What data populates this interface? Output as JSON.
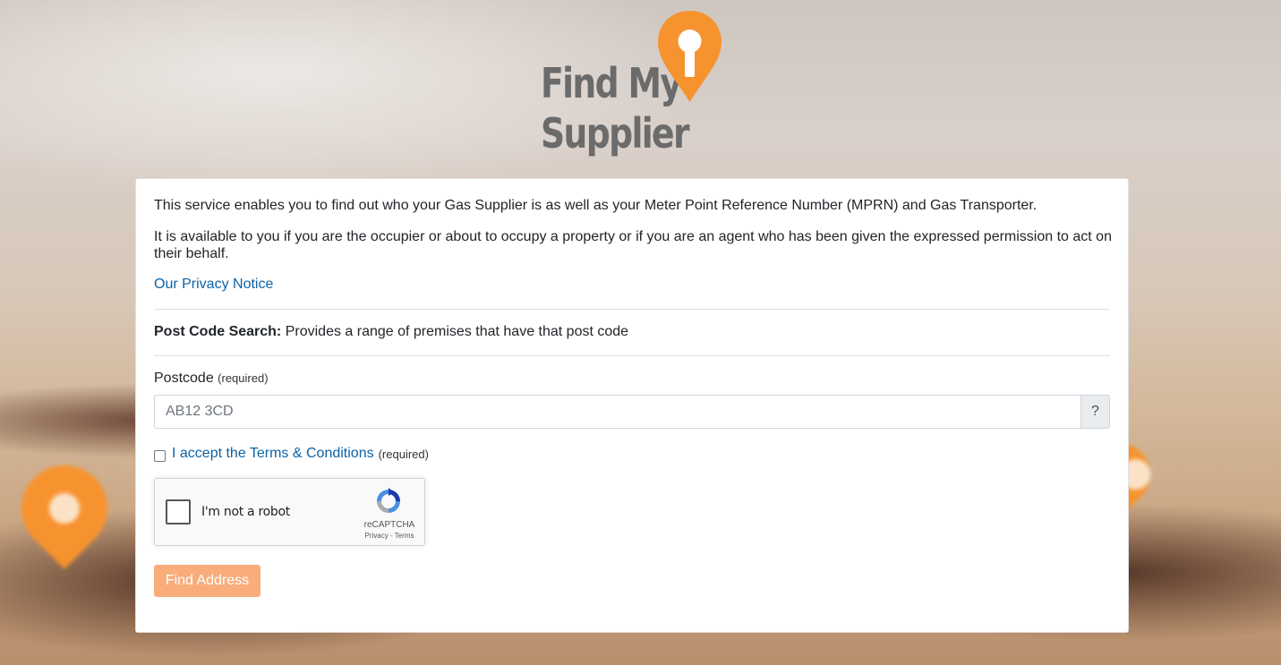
{
  "brand": {
    "logo_text": "Find My\nSupplier",
    "accent_color": "#f7932f"
  },
  "intro": {
    "paragraph_1": "This service enables you to find out who your Gas Supplier is as well as your Meter Point Reference Number (MPRN) and Gas Transporter.",
    "paragraph_2": "It is available to you if you are the occupier or about to occupy a property or if you are an agent who has been given the expressed permission to act on their behalf.",
    "privacy_link": "Our Privacy Notice"
  },
  "search": {
    "title": "Post Code Search:",
    "description": " Provides a range of premises that have that post code"
  },
  "postcode": {
    "label": "Postcode",
    "required": "(required)",
    "placeholder": "AB12 3CD",
    "value": "",
    "help": "?"
  },
  "terms": {
    "checked": false,
    "link_text": "I accept the Terms & Conditions",
    "required": "(required)"
  },
  "recaptcha": {
    "label": "I'm not a robot",
    "brand": "reCAPTCHA",
    "links": "Privacy - Terms"
  },
  "actions": {
    "find_address": "Find Address",
    "button_color": "#f9ad7b"
  },
  "icons": {
    "logo_pin": "location-pin-icon",
    "recaptcha": "recaptcha-icon"
  }
}
